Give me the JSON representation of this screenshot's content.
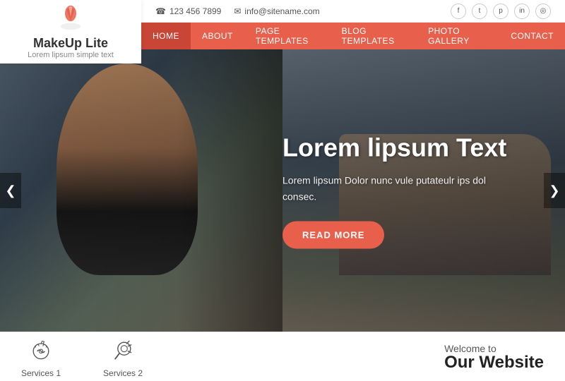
{
  "logo": {
    "title": "MakeUp Lite",
    "subtitle": "Lorem lipsum simple text"
  },
  "topbar": {
    "phone_icon": "☎",
    "phone": "123 456 7899",
    "email_icon": "✉",
    "email": "info@sitename.com",
    "social": [
      "f",
      "t",
      "p",
      "in",
      "📷"
    ]
  },
  "nav": {
    "items": [
      {
        "label": "HOME",
        "active": true
      },
      {
        "label": "ABOUT",
        "active": false
      },
      {
        "label": "PAGE TEMPLATES",
        "active": false
      },
      {
        "label": "BLOG TEMPLATES",
        "active": false
      },
      {
        "label": "PHOTO GALLERY",
        "active": false
      },
      {
        "label": "CONTACT",
        "active": false
      }
    ]
  },
  "hero": {
    "title": "Lorem lipsum Text",
    "description": "Lorem lipsum Dolor nunc vule putateulr ips\ndol consec.",
    "button_label": "READ MORE",
    "arrow_left": "❮",
    "arrow_right": "❯"
  },
  "services": [
    {
      "label": "Services 1"
    },
    {
      "label": "Services 2"
    }
  ],
  "welcome": {
    "text": "Welcome to",
    "title": "Our Website"
  }
}
